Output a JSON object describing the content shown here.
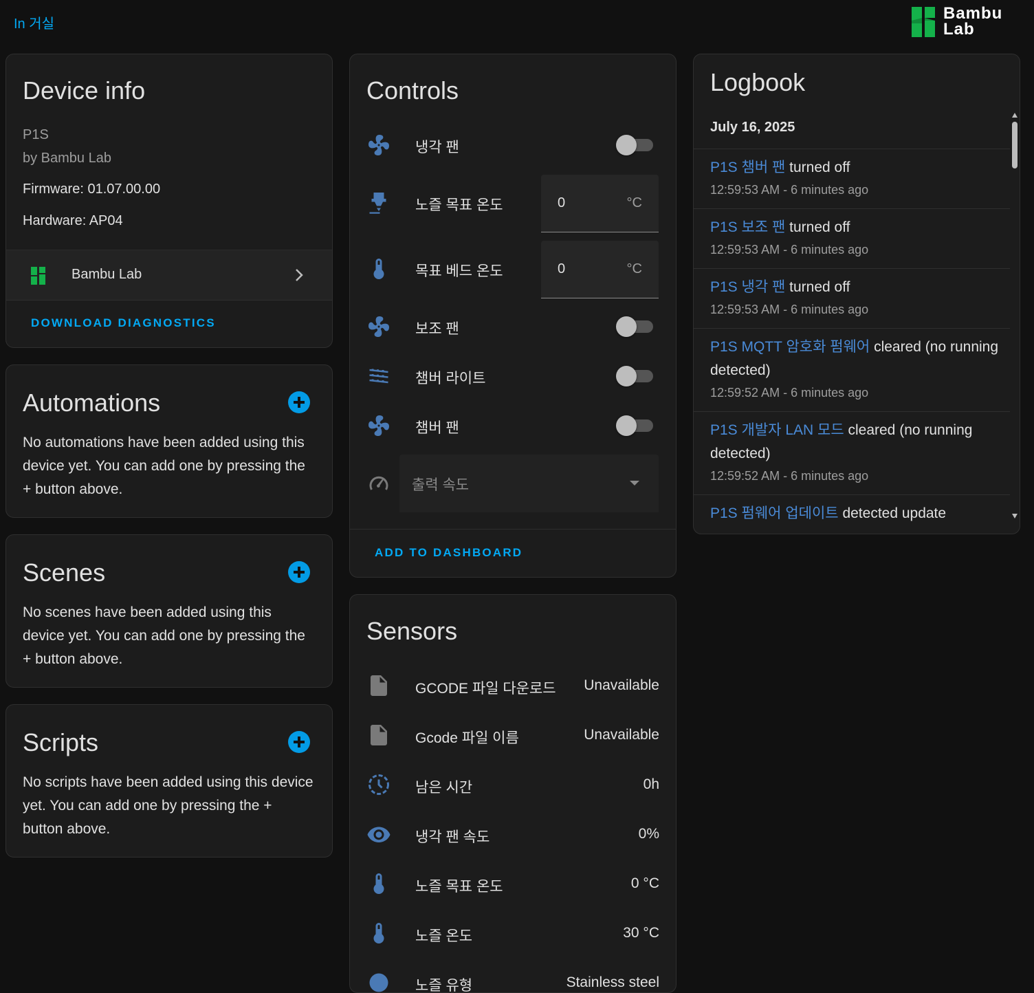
{
  "header": {
    "area_link": "In 거실",
    "logo_text_line1": "Bambu",
    "logo_text_line2": "Lab"
  },
  "colors": {
    "accent": "#03a9f4",
    "entity_link": "#4a8bd8",
    "icon": "#4a7ab5",
    "brand_green": "#14b14a"
  },
  "device_info": {
    "title": "Device info",
    "model": "P1S",
    "manufacturer": "by Bambu Lab",
    "firmware": "Firmware: 01.07.00.00",
    "hardware": "Hardware: AP04",
    "integration_label": "Bambu Lab",
    "download_diagnostics": "DOWNLOAD DIAGNOSTICS"
  },
  "automations": {
    "title": "Automations",
    "empty_text": "No automations have been added using this device yet. You can add one by pressing the + button above."
  },
  "scenes": {
    "title": "Scenes",
    "empty_text": "No scenes have been added using this device yet. You can add one by pressing the + button above."
  },
  "scripts": {
    "title": "Scripts",
    "empty_text": "No scripts have been added using this device yet. You can add one by pressing the + button above."
  },
  "controls": {
    "title": "Controls",
    "items": [
      {
        "label": "냉각 팬",
        "type": "toggle",
        "icon": "fan-icon",
        "on": false
      },
      {
        "label": "노즐 목표 온도",
        "type": "number",
        "icon": "nozzle-icon",
        "value": "0",
        "unit": "°C"
      },
      {
        "label": "목표 베드 온도",
        "type": "number",
        "icon": "thermometer-icon",
        "value": "0",
        "unit": "°C"
      },
      {
        "label": "보조 팬",
        "type": "toggle",
        "icon": "fan-icon",
        "on": false
      },
      {
        "label": "챔버 라이트",
        "type": "toggle",
        "icon": "led-strip-icon",
        "on": false
      },
      {
        "label": "챔버 팬",
        "type": "toggle",
        "icon": "fan-icon",
        "on": false
      },
      {
        "label": "출력 속도",
        "type": "select",
        "icon": "speedometer-icon",
        "disabled": true
      }
    ],
    "add_to_dashboard": "ADD TO DASHBOARD"
  },
  "sensors": {
    "title": "Sensors",
    "items": [
      {
        "label": "GCODE 파일 다운로드",
        "value": "Unavailable",
        "icon": "file-icon"
      },
      {
        "label": "Gcode 파일 이름",
        "value": "Unavailable",
        "icon": "file-icon"
      },
      {
        "label": "남은 시간",
        "value": "0h",
        "icon": "clock-icon"
      },
      {
        "label": "냉각 팬 속도",
        "value": "0%",
        "icon": "eye-icon"
      },
      {
        "label": "노즐 목표 온도",
        "value": "0 °C",
        "icon": "thermometer-icon"
      },
      {
        "label": "노즐 온도",
        "value": "30 °C",
        "icon": "thermometer-icon"
      },
      {
        "label": "노즐 유형",
        "value": "Stainless steel",
        "icon": "nozzle-type-icon"
      }
    ]
  },
  "logbook": {
    "title": "Logbook",
    "date": "July 16, 2025",
    "entries": [
      {
        "entity": "P1S 챔버 팬",
        "message": " turned off",
        "time": "12:59:53 AM - 6 minutes ago"
      },
      {
        "entity": "P1S 보조 팬",
        "message": " turned off",
        "time": "12:59:53 AM - 6 minutes ago"
      },
      {
        "entity": "P1S 냉각 팬",
        "message": " turned off",
        "time": "12:59:53 AM - 6 minutes ago"
      },
      {
        "entity": "P1S MQTT 암호화 펌웨어",
        "message": " cleared (no running detected)",
        "time": "12:59:52 AM - 6 minutes ago"
      },
      {
        "entity": "P1S 개발자 LAN 모드",
        "message": " cleared (no running detected)",
        "time": "12:59:52 AM - 6 minutes ago"
      },
      {
        "entity": "P1S 펌웨어 업데이트",
        "message": " detected update",
        "time": ""
      }
    ]
  }
}
